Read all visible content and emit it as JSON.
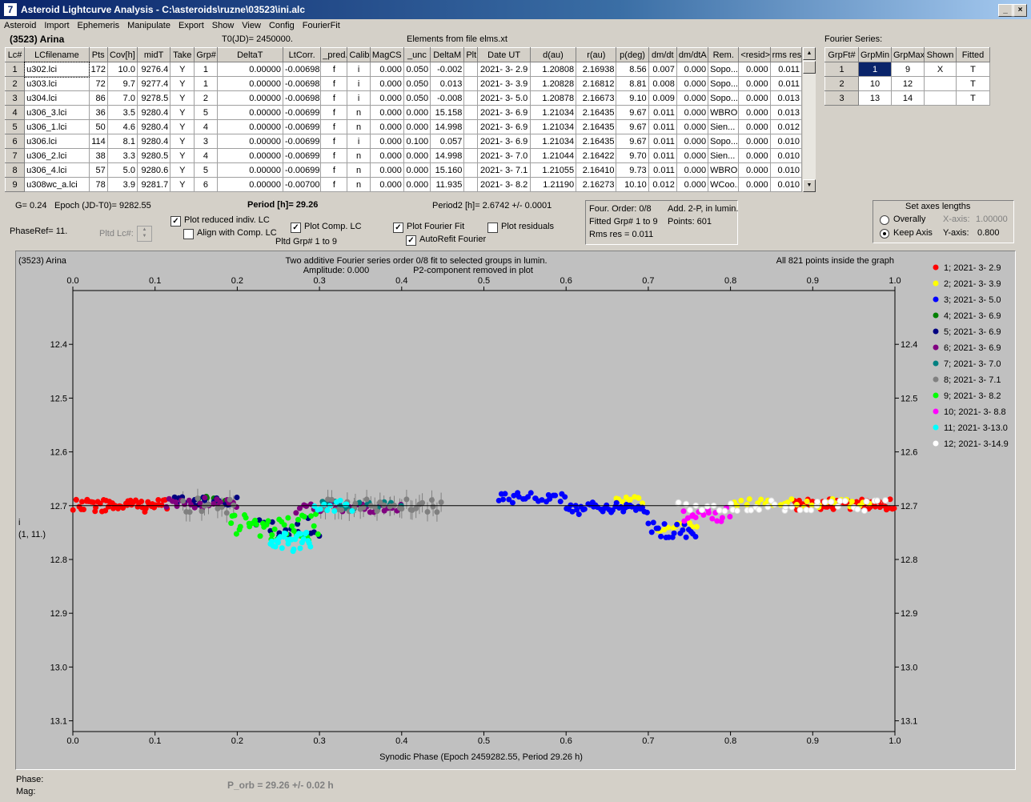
{
  "window": {
    "title": "Asteroid Lightcurve Analysis - C:\\asteroids\\ruzne\\03523\\ini.alc"
  },
  "menu": [
    "Asteroid",
    "Import",
    "Ephemeris",
    "Manipulate",
    "Export",
    "Show",
    "View",
    "Config",
    "FourierFit"
  ],
  "header": {
    "asteroid": "(3523) Arina",
    "t0": "T0(JD)= 2450000.",
    "elements": "Elements from file elms.xt"
  },
  "lc_table": {
    "columns": [
      "Lc#",
      "LCfilename",
      "Pts",
      "Cov[h]",
      "midT",
      "Take",
      "Grp#",
      "DeltaT",
      "LtCorr.",
      "_pred.",
      "Calib.",
      "MagCS",
      "_unc",
      "DeltaM",
      "Plt",
      "Date UT",
      "d(au)",
      "r(au)",
      "p(deg)",
      "dm/dt",
      "dm/dtA",
      "Rem.",
      "<resid>",
      "rms res"
    ],
    "rows": [
      [
        "1",
        "u302.lci",
        "172",
        "10.0",
        "9276.4",
        "Y",
        "1",
        "0.00000",
        "-0.00698",
        "f",
        "i",
        "0.000",
        "0.050",
        "-0.002",
        "",
        "2021- 3- 2.9",
        "1.20808",
        "2.16938",
        "8.56",
        "0.007",
        "0.000",
        "Sopo...",
        "0.000",
        "0.011"
      ],
      [
        "2",
        "u303.lci",
        "72",
        "9.7",
        "9277.4",
        "Y",
        "1",
        "0.00000",
        "-0.00698",
        "f",
        "i",
        "0.000",
        "0.050",
        "0.013",
        "",
        "2021- 3- 3.9",
        "1.20828",
        "2.16812",
        "8.81",
        "0.008",
        "0.000",
        "Sopo...",
        "0.000",
        "0.011"
      ],
      [
        "3",
        "u304.lci",
        "86",
        "7.0",
        "9278.5",
        "Y",
        "2",
        "0.00000",
        "-0.00698",
        "f",
        "i",
        "0.000",
        "0.050",
        "-0.008",
        "",
        "2021- 3- 5.0",
        "1.20878",
        "2.16673",
        "9.10",
        "0.009",
        "0.000",
        "Sopo...",
        "0.000",
        "0.013"
      ],
      [
        "4",
        "u306_3.lci",
        "36",
        "3.5",
        "9280.4",
        "Y",
        "5",
        "0.00000",
        "-0.00699",
        "f",
        "n",
        "0.000",
        "0.000",
        "15.158",
        "",
        "2021- 3- 6.9",
        "1.21034",
        "2.16435",
        "9.67",
        "0.011",
        "0.000",
        "WBRO",
        "0.000",
        "0.013"
      ],
      [
        "5",
        "u306_1.lci",
        "50",
        "4.6",
        "9280.4",
        "Y",
        "4",
        "0.00000",
        "-0.00699",
        "f",
        "n",
        "0.000",
        "0.000",
        "14.998",
        "",
        "2021- 3- 6.9",
        "1.21034",
        "2.16435",
        "9.67",
        "0.011",
        "0.000",
        "Sien...",
        "0.000",
        "0.012"
      ],
      [
        "6",
        "u306.lci",
        "114",
        "8.1",
        "9280.4",
        "Y",
        "3",
        "0.00000",
        "-0.00699",
        "f",
        "i",
        "0.000",
        "0.100",
        "0.057",
        "",
        "2021- 3- 6.9",
        "1.21034",
        "2.16435",
        "9.67",
        "0.011",
        "0.000",
        "Sopo...",
        "0.000",
        "0.010"
      ],
      [
        "7",
        "u306_2.lci",
        "38",
        "3.3",
        "9280.5",
        "Y",
        "4",
        "0.00000",
        "-0.00699",
        "f",
        "n",
        "0.000",
        "0.000",
        "14.998",
        "",
        "2021- 3- 7.0",
        "1.21044",
        "2.16422",
        "9.70",
        "0.011",
        "0.000",
        "Sien...",
        "0.000",
        "0.010"
      ],
      [
        "8",
        "u306_4.lci",
        "57",
        "5.0",
        "9280.6",
        "Y",
        "5",
        "0.00000",
        "-0.00699",
        "f",
        "n",
        "0.000",
        "0.000",
        "15.160",
        "",
        "2021- 3- 7.1",
        "1.21055",
        "2.16410",
        "9.73",
        "0.011",
        "0.000",
        "WBRO",
        "0.000",
        "0.010"
      ],
      [
        "9",
        "u308wc_a.lci",
        "78",
        "3.9",
        "9281.7",
        "Y",
        "6",
        "0.00000",
        "-0.00700",
        "f",
        "n",
        "0.000",
        "0.000",
        "11.935",
        "",
        "2021- 3- 8.2",
        "1.21190",
        "2.16273",
        "10.10",
        "0.012",
        "0.000",
        "WCoo...",
        "0.000",
        "0.010"
      ]
    ]
  },
  "fourier_series": {
    "label": "Fourier Series:",
    "columns": [
      "GrpFt#",
      "GrpMin",
      "GrpMax",
      "Shown",
      "Fitted"
    ],
    "rows": [
      [
        "1",
        "1",
        "9",
        "X",
        "T"
      ],
      [
        "2",
        "10",
        "12",
        "",
        "T"
      ],
      [
        "3",
        "13",
        "14",
        "",
        "T"
      ]
    ]
  },
  "info": {
    "g": "G= 0.24",
    "epoch": "Epoch (JD-T0)= 9282.55",
    "period": "Period [h]= 29.26",
    "period2": "Period2 [h]= 2.6742 +/- 0.0001",
    "phaseref": "PhaseRef= 11.",
    "pltd_lc": "Pltd Lc#:",
    "pltd_grp": "Pltd Grp#  1   to   9"
  },
  "options": {
    "plot_reduced": "Plot reduced indiv. LC",
    "align_comp": "Align with Comp. LC",
    "plot_comp": "Plot Comp. LC",
    "plot_fourier": "Plot Fourier Fit",
    "autorefit": "AutoRefit Fourier",
    "plot_residuals": "Plot residuals"
  },
  "fit_box": {
    "four_order": "Four. Order:  0/8",
    "add": "Add. 2-P, in lumin.",
    "fitted_grp": "Fitted Grp# 1 to 9",
    "points": "Points: 601",
    "rms": "Rms res     = 0.011"
  },
  "axes_box": {
    "title": "Set axes lengths",
    "overally": "Overally",
    "keep_axis": "Keep Axis",
    "x_label": "X-axis:",
    "x_value": "1.00000",
    "y_label": "Y-axis:",
    "y_value": "0.800"
  },
  "chart_data": {
    "type": "scatter",
    "title": "Two additive Fourier series order 0/8 fit to selected groups in lumin.",
    "subtitle_left": "Amplitude: 0.000",
    "subtitle_right": "P2-component removed in plot",
    "corner_left": "(3523) Arina",
    "corner_right": "All 821 points inside the graph",
    "xlabel": "Synodic Phase (Epoch 2459282.55, Period 29.26 h)",
    "ylabel": "i",
    "ylabel2": "(1, 11.)",
    "xlim": [
      0.0,
      1.0
    ],
    "ylim": [
      12.35,
      13.15
    ],
    "y_inverted": true,
    "grid": false,
    "legend_position": "right",
    "x_ticks": [
      "0.0",
      "0.1",
      "0.2",
      "0.3",
      "0.4",
      "0.5",
      "0.6",
      "0.7",
      "0.8",
      "0.9",
      "1.0"
    ],
    "y_ticks": [
      "12.4",
      "12.5",
      "12.6",
      "12.7",
      "12.8",
      "12.9",
      "13.0",
      "13.1"
    ],
    "fit_line_y": 12.7,
    "series": [
      {
        "name": "1; 2021- 3- 2.9",
        "color": "#ff0000"
      },
      {
        "name": "2; 2021- 3- 3.9",
        "color": "#ffff00"
      },
      {
        "name": "3; 2021- 3- 5.0",
        "color": "#0000ff"
      },
      {
        "name": "4; 2021- 3- 6.9",
        "color": "#008000"
      },
      {
        "name": "5; 2021- 3- 6.9",
        "color": "#000080"
      },
      {
        "name": "6; 2021- 3- 6.9",
        "color": "#800080"
      },
      {
        "name": "7; 2021- 3- 7.0",
        "color": "#008080"
      },
      {
        "name": "8; 2021- 3- 7.1",
        "color": "#808080"
      },
      {
        "name": "9; 2021- 3- 8.2",
        "color": "#00ff00"
      },
      {
        "name": "10; 2021- 3- 8.8",
        "color": "#ff00ff"
      },
      {
        "name": "11; 2021- 3-13.0",
        "color": "#00ffff"
      },
      {
        "name": "12; 2021- 3-14.9",
        "color": "#ffffff"
      }
    ],
    "segments": [
      {
        "s": 0,
        "x0": 0.0,
        "x1": 0.115,
        "n": 55,
        "y": 12.7,
        "spread": 0.012
      },
      {
        "s": 0,
        "x0": 0.875,
        "x1": 1.0,
        "n": 60,
        "y": 12.698,
        "spread": 0.01
      },
      {
        "s": 1,
        "x0": 0.66,
        "x1": 0.695,
        "n": 10,
        "y": 12.69,
        "spread": 0.008
      },
      {
        "s": 1,
        "x0": 0.71,
        "x1": 0.76,
        "n": 12,
        "y": 12.74,
        "spread": 0.008
      },
      {
        "s": 1,
        "x0": 0.8,
        "x1": 0.97,
        "n": 30,
        "y": 12.695,
        "spread": 0.008
      },
      {
        "s": 2,
        "x0": 0.515,
        "x1": 0.6,
        "n": 25,
        "y": 12.685,
        "spread": 0.01
      },
      {
        "s": 2,
        "x0": 0.6,
        "x1": 0.7,
        "n": 40,
        "y": 12.705,
        "spread": 0.012
      },
      {
        "s": 2,
        "x0": 0.7,
        "x1": 0.76,
        "n": 20,
        "y": 12.745,
        "spread": 0.015
      },
      {
        "s": 3,
        "x0": 0.15,
        "x1": 0.2,
        "n": 8,
        "y": 12.69,
        "spread": 0.012
      },
      {
        "s": 4,
        "x0": 0.12,
        "x1": 0.2,
        "n": 20,
        "y": 12.69,
        "spread": 0.01
      },
      {
        "s": 4,
        "x0": 0.22,
        "x1": 0.3,
        "n": 18,
        "y": 12.74,
        "spread": 0.02
      },
      {
        "s": 5,
        "x0": 0.11,
        "x1": 0.2,
        "n": 22,
        "y": 12.695,
        "spread": 0.01
      },
      {
        "s": 5,
        "x0": 0.27,
        "x1": 0.4,
        "n": 30,
        "y": 12.705,
        "spread": 0.01
      },
      {
        "s": 6,
        "x0": 0.3,
        "x1": 0.4,
        "n": 15,
        "y": 12.7,
        "spread": 0.008
      },
      {
        "s": 7,
        "x0": 0.13,
        "x1": 0.2,
        "n": 12,
        "y": 12.7,
        "spread": 0.015
      },
      {
        "s": 7,
        "x0": 0.3,
        "x1": 0.45,
        "n": 35,
        "y": 12.7,
        "spread": 0.012
      },
      {
        "s": 8,
        "x0": 0.19,
        "x1": 0.3,
        "n": 40,
        "y": 12.74,
        "spread": 0.025
      },
      {
        "s": 9,
        "x0": 0.74,
        "x1": 0.8,
        "n": 18,
        "y": 12.715,
        "spread": 0.015
      },
      {
        "s": 10,
        "x0": 0.24,
        "x1": 0.29,
        "n": 30,
        "y": 12.77,
        "spread": 0.02
      },
      {
        "s": 10,
        "x0": 0.29,
        "x1": 0.34,
        "n": 12,
        "y": 12.7,
        "spread": 0.01
      },
      {
        "s": 11,
        "x0": 0.73,
        "x1": 0.99,
        "n": 40,
        "y": 12.7,
        "spread": 0.01
      }
    ]
  },
  "footer": {
    "phase": "Phase:",
    "mag": "Mag:",
    "porb": "P_orb = 29.26 +/- 0.02 h"
  }
}
